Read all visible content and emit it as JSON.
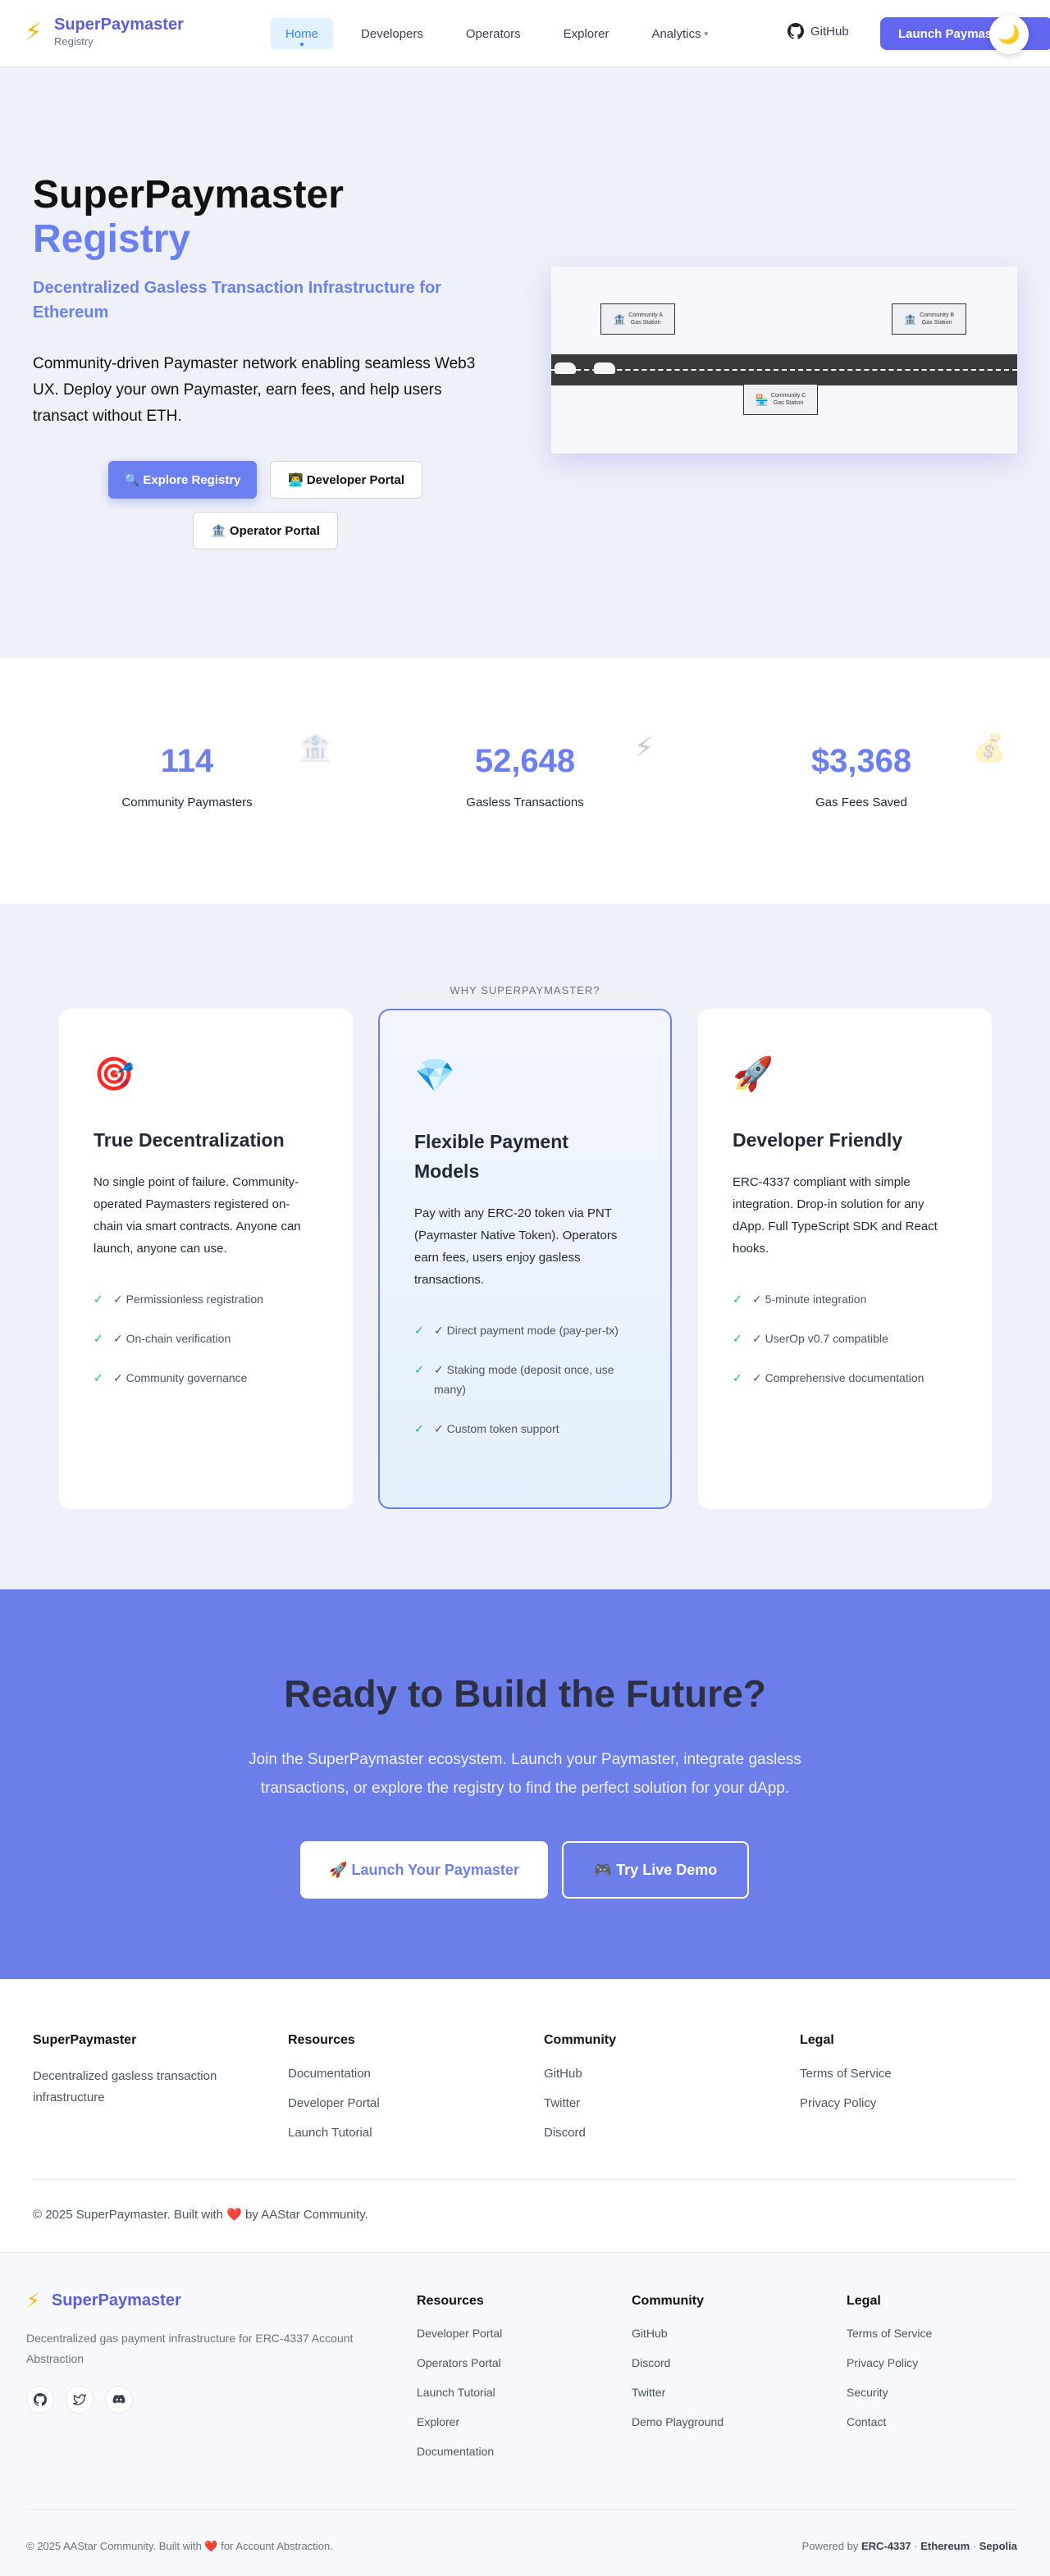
{
  "nav": {
    "brand_name": "SuperPaymaster",
    "brand_sub": "Registry",
    "links": [
      {
        "label": "Home"
      },
      {
        "label": "Developers"
      },
      {
        "label": "Operators"
      },
      {
        "label": "Explorer"
      },
      {
        "label": "Analytics"
      }
    ],
    "github_label": "GitHub",
    "launch_label": "Launch Paymaster",
    "accent_color": "#6366f1"
  },
  "hero": {
    "title_line1": "SuperPaymaster",
    "title_line2": "Registry",
    "tagline": "Decentralized Gasless Transaction Infrastructure for Ethereum",
    "description": "Community-driven Paymaster network enabling seamless Web3 UX. Deploy your own Paymaster, earn fees, and help users transact without ETH.",
    "btn_explore": "🔍 Explore Registry",
    "btn_developer": "👨‍💻 Developer Portal",
    "btn_operator": "🏦 Operator Portal",
    "stations": [
      {
        "name": "Community A",
        "sub": "Gas Station"
      },
      {
        "name": "Community B",
        "sub": "Gas Station"
      },
      {
        "name": "Community C",
        "sub": "Gas Station"
      }
    ]
  },
  "stats": [
    {
      "value": "114",
      "label": "Community Paymasters",
      "icon": "🏦"
    },
    {
      "value": "52,648",
      "label": "Gasless Transactions",
      "icon": "⚡"
    },
    {
      "value": "$3,368",
      "label": "Gas Fees Saved",
      "icon": "💰"
    }
  ],
  "features": {
    "eyebrow": "WHY SUPERPAYMASTER?",
    "cards": [
      {
        "icon": "🎯",
        "title": "True Decentralization",
        "description": "No single point of failure. Community-operated Paymasters registered on-chain via smart contracts. Anyone can launch, anyone can use.",
        "items": [
          "✓ Permissionless registration",
          "✓ On-chain verification",
          "✓ Community governance"
        ]
      },
      {
        "icon": "💎",
        "title": "Flexible Payment Models",
        "description": "Pay with any ERC-20 token via PNT (Paymaster Native Token). Operators earn fees, users enjoy gasless transactions.",
        "items": [
          "✓ Direct payment mode (pay-per-tx)",
          "✓ Staking mode (deposit once, use many)",
          "✓ Custom token support"
        ]
      },
      {
        "icon": "🚀",
        "title": "Developer Friendly",
        "description": "ERC-4337 compliant with simple integration. Drop-in solution for any dApp. Full TypeScript SDK and React hooks.",
        "items": [
          "✓ 5-minute integration",
          "✓ UserOp v0.7 compatible",
          "✓ Comprehensive documentation"
        ]
      }
    ]
  },
  "cta": {
    "title": "Ready to Build the Future?",
    "description": "Join the SuperPaymaster ecosystem. Launch your Paymaster, integrate gasless transactions, or explore the registry to find the perfect solution for your dApp.",
    "btn_launch": "🚀 Launch Your Paymaster",
    "btn_demo": "🎮 Try Live Demo",
    "bg_color": "#6b7ee9"
  },
  "footer1": {
    "brand_head": "SuperPaymaster",
    "brand_text": "Decentralized gasless transaction infrastructure",
    "resources_head": "Resources",
    "resources": [
      "Documentation",
      "Developer Portal",
      "Launch Tutorial"
    ],
    "community_head": "Community",
    "community": [
      "GitHub",
      "Twitter",
      "Discord"
    ],
    "legal_head": "Legal",
    "legal": [
      "Terms of Service",
      "Privacy Policy"
    ],
    "copyright": "© 2025 SuperPaymaster. Built with ❤️ by AAStar Community."
  },
  "footer2": {
    "brand_name": "SuperPaymaster",
    "description": "Decentralized gas payment infrastructure for ERC-4337 Account Abstraction",
    "resources_head": "Resources",
    "resources": [
      "Developer Portal",
      "Operators Portal",
      "Launch Tutorial",
      "Explorer",
      "Documentation"
    ],
    "community_head": "Community",
    "community": [
      "GitHub",
      "Discord",
      "Twitter",
      "Demo Playground"
    ],
    "legal_head": "Legal",
    "legal": [
      "Terms of Service",
      "Privacy Policy",
      "Security",
      "Contact"
    ],
    "copyright": "© 2025 AAStar Community. Built with ❤️ for Account Abstraction.",
    "powered_prefix": "Powered by",
    "powered_items": [
      "ERC-4337",
      "Ethereum",
      "Sepolia"
    ]
  }
}
